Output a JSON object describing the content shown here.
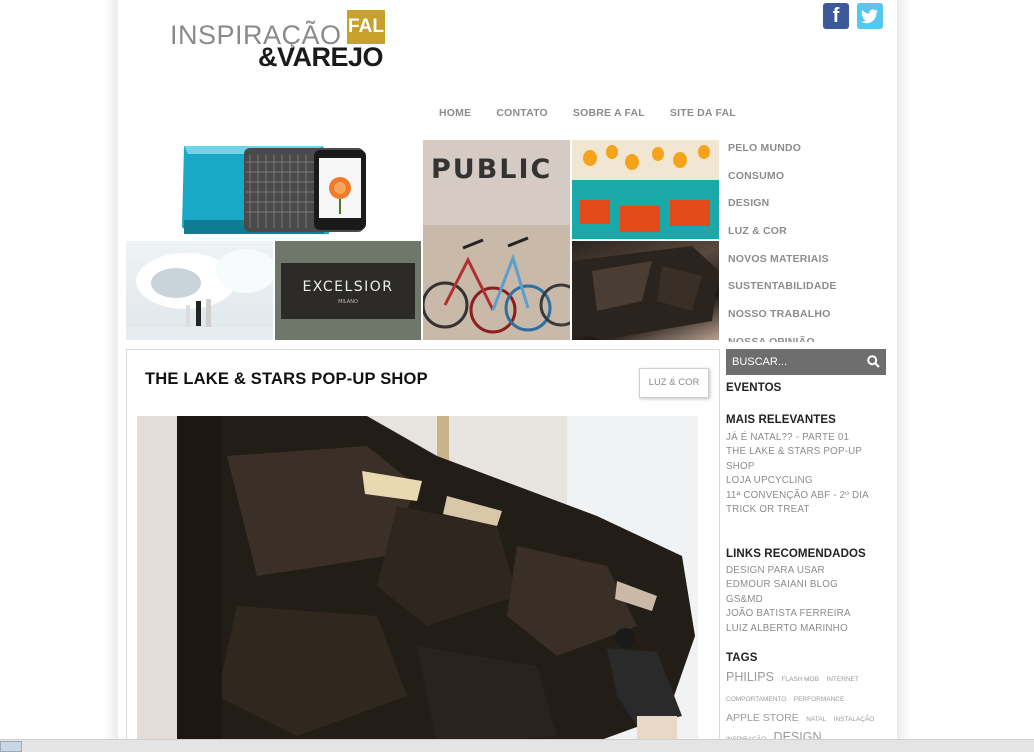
{
  "logo": {
    "line1": "INSPIRAÇÃO",
    "badge": "FAL",
    "line2": "&VAREJO"
  },
  "social": {
    "facebook_glyph": "f",
    "twitter_glyph": "t"
  },
  "topnav": [
    "HOME",
    "CONTATO",
    "SOBRE A FAL",
    "SITE DA FAL"
  ],
  "mosaic": {
    "public_sign": "PUBLIC",
    "excelsior_sign": "EXCELSIOR",
    "excelsior_sub": "MILANO"
  },
  "sidemenu": [
    "PELO MUNDO",
    "CONSUMO",
    "DESIGN",
    "LUZ & COR",
    "NOVOS MATERIAIS",
    "SUSTENTABILIDADE",
    "NOSSO TRABALHO",
    "NOSSA OPINIÃO"
  ],
  "article": {
    "title": "THE LAKE & STARS POP-UP SHOP",
    "category": "LUZ & COR"
  },
  "sidebar": {
    "search_placeholder": "BUSCAR...",
    "eventos": "EVENTOS",
    "mais_relevantes": {
      "heading": "MAIS RELEVANTES",
      "items": [
        "JÁ É NATAL?? - PARTE 01",
        "THE LAKE & STARS POP-UP SHOP",
        "LOJA UPCYCLING",
        "11ª CONVENÇÃO ABF - 2º DIA",
        "TRICK OR TREAT"
      ]
    },
    "links": {
      "heading": "LINKS RECOMENDADOS",
      "items": [
        "DESIGN PARA USAR",
        "EDMOUR SAIANI BLOG",
        "GS&MD",
        "JOÃO BATISTA FERREIRA",
        "LUIZ ALBERTO MARINHO"
      ]
    },
    "tags": {
      "heading": "TAGS",
      "items": [
        "PHILIPS",
        "FLASH MOB",
        "INTERNET",
        "COMPORTAMENTO",
        "PERFORMANCE",
        "APPLE STORE",
        "NATAL",
        "INSTALAÇÃO",
        "INSPIRAÇÃO",
        "DESIGN"
      ]
    }
  }
}
